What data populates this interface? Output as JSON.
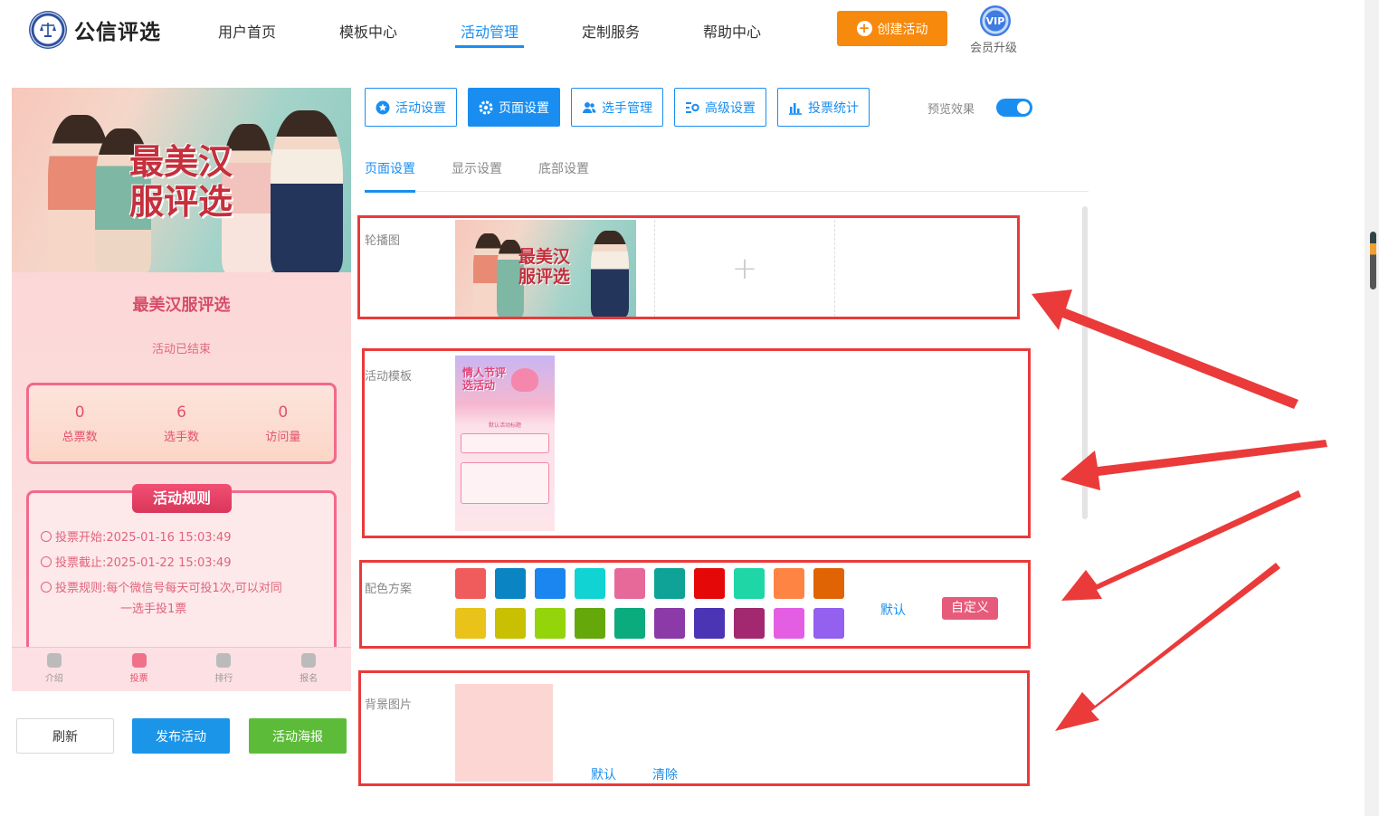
{
  "header": {
    "brand": "公信评选",
    "nav": [
      "用户首页",
      "模板中心",
      "活动管理",
      "定制服务",
      "帮助中心"
    ],
    "active_nav": "活动管理",
    "create_button": "创建活动",
    "vip_badge": "VIP",
    "vip_label": "会员升级"
  },
  "preview": {
    "banner_title": "最美汉服评选",
    "activity_name": "最美汉服评选",
    "status": "活动已结束",
    "stats": [
      {
        "value": "0",
        "label": "总票数"
      },
      {
        "value": "6",
        "label": "选手数"
      },
      {
        "value": "0",
        "label": "访问量"
      }
    ],
    "rules_title": "活动规则",
    "rules": {
      "start_label": "投票开始:",
      "start": "2025-01-16 15:03:49",
      "end_label": "投票截止:",
      "end": "2025-01-22 15:03:49",
      "rule_label": "投票规则:",
      "rule_line1": "每个微信号每天可投1次,可以对同",
      "rule_line2": "一选手投1票"
    },
    "tabbar": [
      "介绍",
      "投票",
      "排行",
      "报名"
    ],
    "active_tab": "投票"
  },
  "left_buttons": {
    "refresh": "刷新",
    "publish": "发布活动",
    "poster": "活动海报"
  },
  "settings": {
    "tabs": [
      {
        "label": "活动设置",
        "icon": "star-icon"
      },
      {
        "label": "页面设置",
        "icon": "gear-icon"
      },
      {
        "label": "选手管理",
        "icon": "users-icon"
      },
      {
        "label": "高级设置",
        "icon": "sliders-icon"
      },
      {
        "label": "投票统计",
        "icon": "bar-chart-icon"
      }
    ],
    "active_tab": "页面设置",
    "preview_toggle_label": "预览效果",
    "preview_toggle_on": true,
    "subtabs": [
      "页面设置",
      "显示设置",
      "底部设置"
    ],
    "active_subtab": "页面设置",
    "carousel_label": "轮播图",
    "carousel_thumb_title": "最美汉服评选",
    "template_label": "活动模板",
    "template_thumb_title": "情人节评选活动",
    "template_thumb_caption": "默认活动标题",
    "color_label": "配色方案",
    "colors_row1": [
      "#f05b5b",
      "#0a84c2",
      "#1b86ef",
      "#12d3d3",
      "#e7699a",
      "#0ea396",
      "#e40808",
      "#1fd6a7",
      "#fe8444",
      "#e06404"
    ],
    "colors_row2": [
      "#e9c21a",
      "#c8c000",
      "#94d40b",
      "#64a80a",
      "#0aab7c",
      "#8b3aa8",
      "#4b35b5",
      "#a2296f",
      "#e45ee4",
      "#9360f0"
    ],
    "color_default": "默认",
    "color_custom": "自定义",
    "bg_label": "背景图片",
    "bg_default": "默认",
    "bg_clear": "清除",
    "bg_color": "#fcd6d3"
  }
}
